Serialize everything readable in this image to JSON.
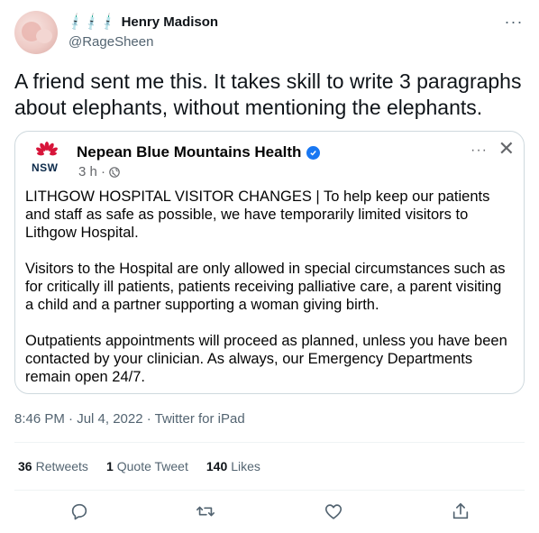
{
  "tweet": {
    "author": {
      "emojis": [
        "💉",
        "💉",
        "💉"
      ],
      "display_name": "Henry Madison",
      "handle": "@RageSheen"
    },
    "text": "A friend sent me this. It takes skill to write 3 paragraphs about elephants, without mentioning the elephants.",
    "timestamp": "8:46 PM · Jul 4, 2022 · Twitter for iPad",
    "stats": {
      "retweets_count": "36",
      "retweets_label": "Retweets",
      "quote_count": "1",
      "quote_label": "Quote Tweet",
      "likes_count": "140",
      "likes_label": "Likes"
    },
    "actions": [
      "reply-icon",
      "retweet-icon",
      "like-icon",
      "share-icon"
    ]
  },
  "embedded_post": {
    "logo_text": "NSW",
    "page_name": "Nepean Blue Mountains Health",
    "time": "3 h ·",
    "paragraphs": [
      "LITHGOW HOSPITAL VISITOR CHANGES | To help keep our patients and staff as safe as possible, we have temporarily limited visitors to Lithgow Hospital.",
      "Visitors to the Hospital are only allowed in special circumstances such as for critically ill patients, patients receiving palliative care, a parent visiting a child and a partner supporting a woman giving birth.",
      "Outpatients appointments will proceed as planned, unless you have been contacted by your clinician. As always, our Emergency Departments remain open 24/7."
    ]
  },
  "colors": {
    "text_primary": "#0f1419",
    "text_secondary": "#536471",
    "border": "#cfd9de",
    "facebook_blue": "#1877f2",
    "nsw_red": "#d7153a"
  }
}
